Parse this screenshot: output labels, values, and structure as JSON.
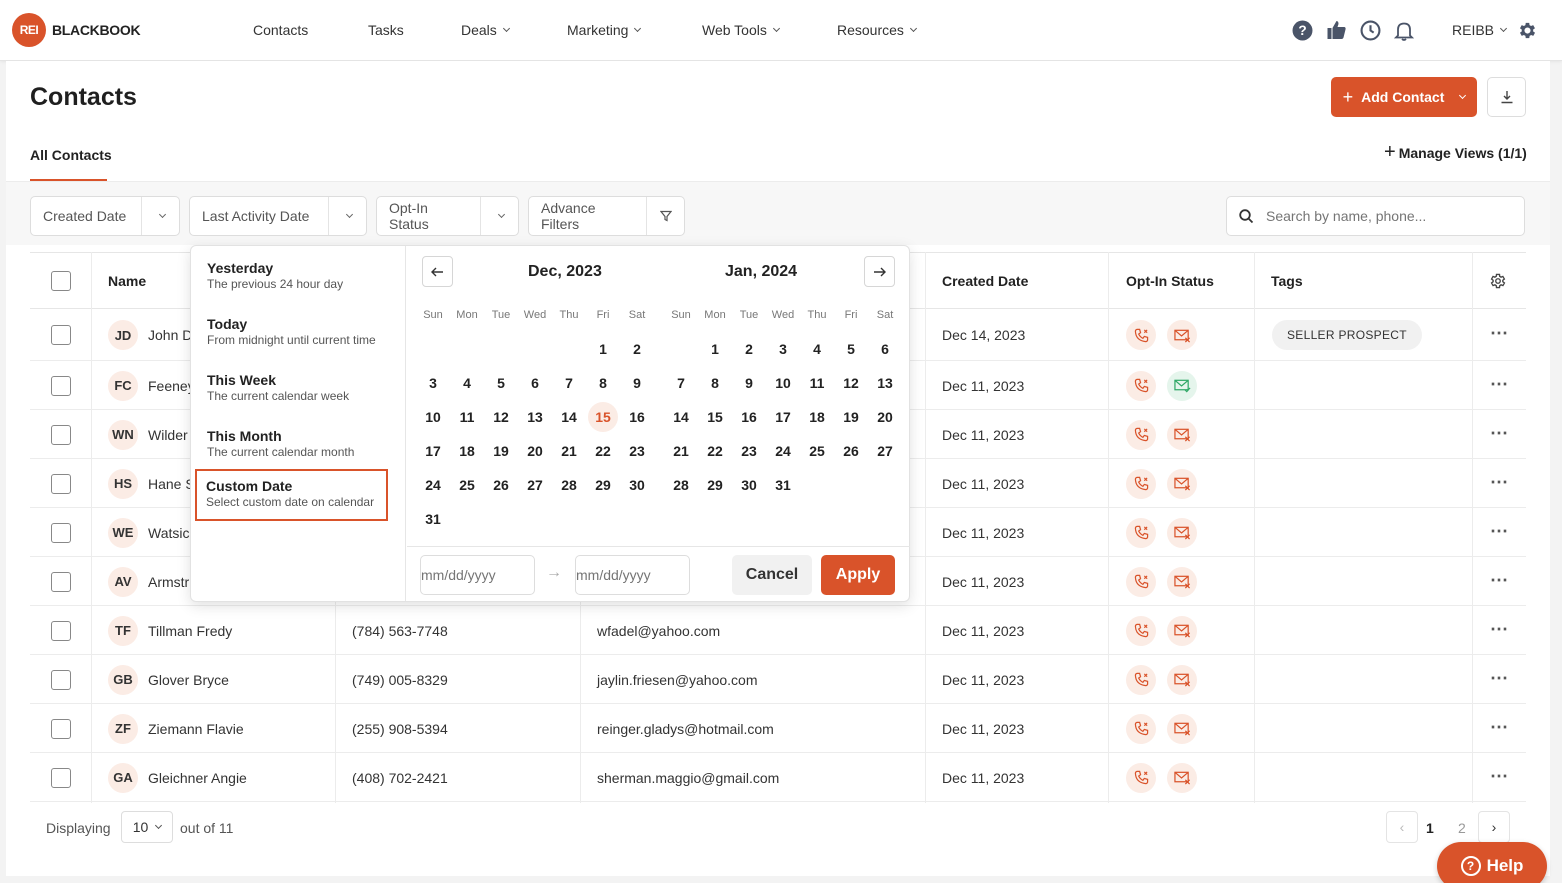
{
  "brand": {
    "badge": "REI",
    "name": "BLACKBOOK",
    "accent": "#d9532a"
  },
  "nav": {
    "links": [
      "Contacts",
      "Tasks",
      "Deals",
      "Marketing",
      "Web Tools",
      "Resources"
    ],
    "icons": [
      "help-circle-icon",
      "thumbs-up-icon",
      "clock-icon",
      "bell-icon"
    ],
    "account": "REIBB"
  },
  "page": {
    "title": "Contacts",
    "add_contact": "Add Contact",
    "tab_all": "All Contacts",
    "manage_views": "Manage Views (1/1)"
  },
  "filters": {
    "created_date": "Created Date",
    "last_activity": "Last Activity Date",
    "opt_in": "Opt-In Status",
    "advance": "Advance Filters",
    "search_placeholder": "Search by name, phone..."
  },
  "table": {
    "headers": {
      "name": "Name",
      "created": "Created Date",
      "optin": "Opt-In Status",
      "tags": "Tags"
    },
    "rows": [
      {
        "initials": "JD",
        "name": "John D",
        "phone": "",
        "email": "",
        "created": "Dec 14, 2023",
        "mail_ok": false,
        "tag": "SELLER PROSPECT"
      },
      {
        "initials": "FC",
        "name": "Feeney",
        "phone": "",
        "email": "",
        "created": "Dec 11, 2023",
        "mail_ok": true,
        "tag": ""
      },
      {
        "initials": "WN",
        "name": "Wilder",
        "phone": "",
        "email": "",
        "created": "Dec 11, 2023",
        "mail_ok": false,
        "tag": ""
      },
      {
        "initials": "HS",
        "name": "Hane S",
        "phone": "",
        "email": "",
        "created": "Dec 11, 2023",
        "mail_ok": false,
        "tag": ""
      },
      {
        "initials": "WE",
        "name": "Watsic",
        "phone": "",
        "email": "",
        "created": "Dec 11, 2023",
        "mail_ok": false,
        "tag": ""
      },
      {
        "initials": "AV",
        "name": "Armstr",
        "phone": "",
        "email": "",
        "created": "Dec 11, 2023",
        "mail_ok": false,
        "tag": ""
      },
      {
        "initials": "TF",
        "name": "Tillman Fredy",
        "phone": "(784) 563-7748",
        "email": "wfadel@yahoo.com",
        "created": "Dec 11, 2023",
        "mail_ok": false,
        "tag": ""
      },
      {
        "initials": "GB",
        "name": "Glover Bryce",
        "phone": "(749) 005-8329",
        "email": "jaylin.friesen@yahoo.com",
        "created": "Dec 11, 2023",
        "mail_ok": false,
        "tag": ""
      },
      {
        "initials": "ZF",
        "name": "Ziemann Flavie",
        "phone": "(255) 908-5394",
        "email": "reinger.gladys@hotmail.com",
        "created": "Dec 11, 2023",
        "mail_ok": false,
        "tag": ""
      },
      {
        "initials": "GA",
        "name": "Gleichner Angie",
        "phone": "(408) 702-2421",
        "email": "sherman.maggio@gmail.com",
        "created": "Dec 11, 2023",
        "mail_ok": false,
        "tag": ""
      }
    ]
  },
  "footer": {
    "displaying": "Displaying",
    "per_page": "10",
    "out_of": "out of 11",
    "pages": [
      "1",
      "2"
    ]
  },
  "date_dropdown": {
    "presets": [
      {
        "title": "Yesterday",
        "sub": "The previous 24 hour day"
      },
      {
        "title": "Today",
        "sub": "From midnight until current time"
      },
      {
        "title": "This Week",
        "sub": "The current calendar week"
      },
      {
        "title": "This Month",
        "sub": "The current calendar month"
      },
      {
        "title": "Custom Date",
        "sub": "Select custom date on calendar"
      }
    ],
    "selected_preset": "Custom Date",
    "weekdays": [
      "Sun",
      "Mon",
      "Tue",
      "Wed",
      "Thu",
      "Fri",
      "Sat"
    ],
    "months": [
      {
        "title": "Dec, 2023",
        "first_weekday": 5,
        "days": 31,
        "highlight": 15
      },
      {
        "title": "Jan, 2024",
        "first_weekday": 1,
        "days": 31,
        "highlight": null
      }
    ],
    "start_placeholder": "mm/dd/yyyy",
    "end_placeholder": "mm/dd/yyyy",
    "cancel": "Cancel",
    "apply": "Apply"
  },
  "help": "Help"
}
